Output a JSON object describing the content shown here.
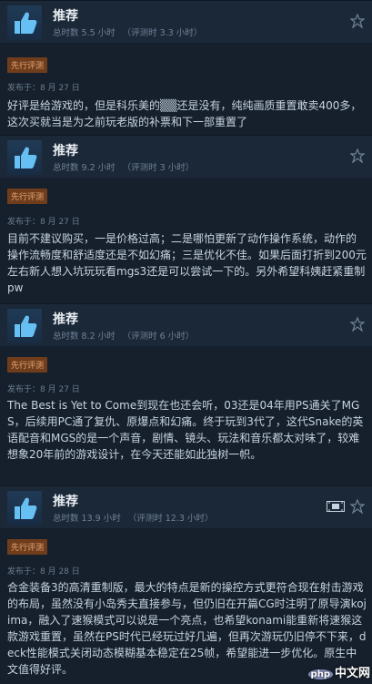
{
  "reviews": [
    {
      "verdict": "推荐",
      "hours_total": "总时数 5.5 小时",
      "hours_at_review": "（评测时 3.3 小时）",
      "badge": "先行评测",
      "posted": "发布于：8 月 27 日",
      "text": "好评是给游戏的，但是科乐美的▒▒还是没有，纯纯画质重置敢卖400多，这次买就当是为之前玩老版的补票和下一部重置了"
    },
    {
      "verdict": "推荐",
      "hours_total": "总时数 9.2 小时",
      "hours_at_review": "（评测时 3 小时）",
      "badge": "先行评测",
      "posted": "发布于：8 月 27 日",
      "text": "目前不建议购买，一是价格过高；二是哪怕更新了动作操作系统，动作的操作流畅度和舒适度还是不如幻痛；三是优化不佳。如果后面打折到200元左右新人想入坑玩玩看mgs3还是可以尝试一下的。另外希望科姨赶紧重制pw"
    },
    {
      "verdict": "推荐",
      "hours_total": "总时数 8.2 小时",
      "hours_at_review": "（评测时 6 小时）",
      "badge": "先行评测",
      "posted": "发布于：8 月 27 日",
      "text": "The Best is Yet to Come到现在也还会听，03还是04年用PS通关了MGS，后续用PC通了复仇、原爆点和幻痛。终于玩到3代了，这代Snake的英语配音和MGS的是一个声音，剧情、镜头、玩法和音乐都太对味了，较难想象20年前的游戏设计，在今天还能如此独树一帜。"
    },
    {
      "verdict": "推荐",
      "hours_total": "总时数 13.9 小时",
      "hours_at_review": "（评测时 12.3 小时）",
      "badge": "先行评测",
      "posted": "发布于：8 月 28 日",
      "text": "合金装备3的高清重制版，最大的特点是新的操控方式更符合现在射击游戏的布局，虽然没有小岛秀夫直接参与，但仍旧在开篇CG时注明了原导演kojima，融入了速猴模式可以说是一个亮点，也希望konami能重新将速猴这款游戏重置，虽然在PS时代已经玩过好几遍，但再次游玩仍旧停不下来，deck性能模式关闭动态模糊基本稳定在25帧，希望能进一步优化。原生中文值得好评。"
    }
  ],
  "watermark": {
    "logo": "php",
    "text": "中文网"
  }
}
